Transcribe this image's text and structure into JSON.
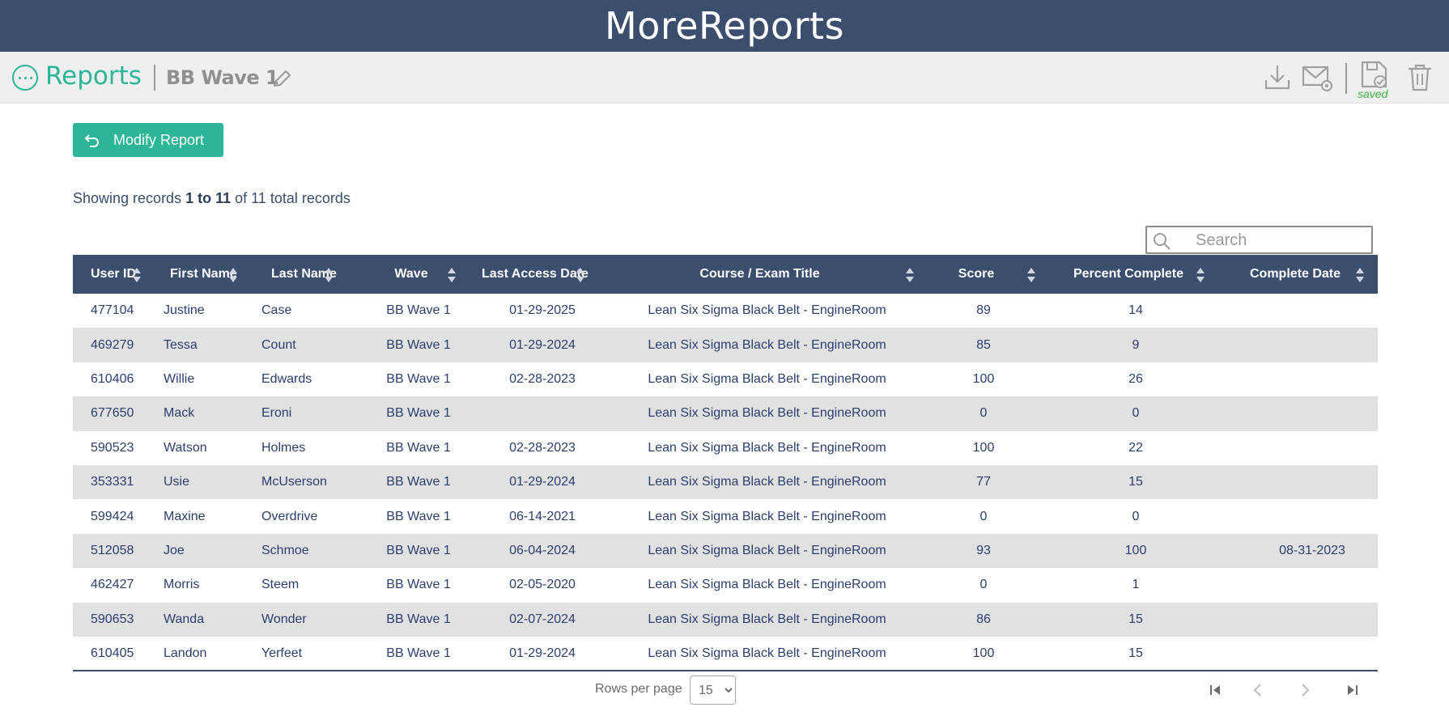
{
  "app": {
    "title": "MoreReports"
  },
  "toolbar": {
    "section_title": "Reports",
    "report_name": "BB Wave 1",
    "saved_label": "saved"
  },
  "actions": {
    "modify_label": "Modify Report"
  },
  "records": {
    "prefix": "Showing records ",
    "range": "1 to 11",
    "middle": " of ",
    "total": "11",
    "suffix": " total records"
  },
  "search": {
    "placeholder": "Search",
    "value": ""
  },
  "table": {
    "columns": [
      "User ID",
      "First Name",
      "Last Name",
      "Wave",
      "Last Access Date",
      "Course / Exam Title",
      "Score",
      "Percent Complete",
      "Complete Date"
    ],
    "rows": [
      [
        "477104",
        "Justine",
        "Case",
        "BB Wave 1",
        "01-29-2025",
        "Lean Six Sigma Black Belt - EngineRoom",
        "89",
        "14",
        ""
      ],
      [
        "469279",
        "Tessa",
        "Count",
        "BB Wave 1",
        "01-29-2024",
        "Lean Six Sigma Black Belt - EngineRoom",
        "85",
        "9",
        ""
      ],
      [
        "610406",
        "Willie",
        "Edwards",
        "BB Wave 1",
        "02-28-2023",
        "Lean Six Sigma Black Belt - EngineRoom",
        "100",
        "26",
        ""
      ],
      [
        "677650",
        "Mack",
        "Eroni",
        "BB Wave 1",
        "",
        "Lean Six Sigma Black Belt - EngineRoom",
        "0",
        "0",
        ""
      ],
      [
        "590523",
        "Watson",
        "Holmes",
        "BB Wave 1",
        "02-28-2023",
        "Lean Six Sigma Black Belt - EngineRoom",
        "100",
        "22",
        ""
      ],
      [
        "353331",
        "Usie",
        "McUserson",
        "BB Wave 1",
        "01-29-2024",
        "Lean Six Sigma Black Belt - EngineRoom",
        "77",
        "15",
        ""
      ],
      [
        "599424",
        "Maxine",
        "Overdrive",
        "BB Wave 1",
        "06-14-2021",
        "Lean Six Sigma Black Belt - EngineRoom",
        "0",
        "0",
        ""
      ],
      [
        "512058",
        "Joe",
        "Schmoe",
        "BB Wave 1",
        "06-04-2024",
        "Lean Six Sigma Black Belt - EngineRoom",
        "93",
        "100",
        "08-31-2023"
      ],
      [
        "462427",
        "Morris",
        "Steem",
        "BB Wave 1",
        "02-05-2020",
        "Lean Six Sigma Black Belt - EngineRoom",
        "0",
        "1",
        ""
      ],
      [
        "590653",
        "Wanda",
        "Wonder",
        "BB Wave 1",
        "02-07-2024",
        "Lean Six Sigma Black Belt - EngineRoom",
        "86",
        "15",
        ""
      ],
      [
        "610405",
        "Landon",
        "Yerfeet",
        "BB Wave 1",
        "01-29-2024",
        "Lean Six Sigma Black Belt - EngineRoom",
        "100",
        "15",
        ""
      ]
    ]
  },
  "pagination": {
    "rows_label": "Rows per page",
    "rows_per_page": "15",
    "options": [
      "15"
    ]
  },
  "colors": {
    "header": "#3b4e6e",
    "accent": "#2cb596",
    "row_alt": "#e1e1e1",
    "saved": "#3fae45"
  }
}
